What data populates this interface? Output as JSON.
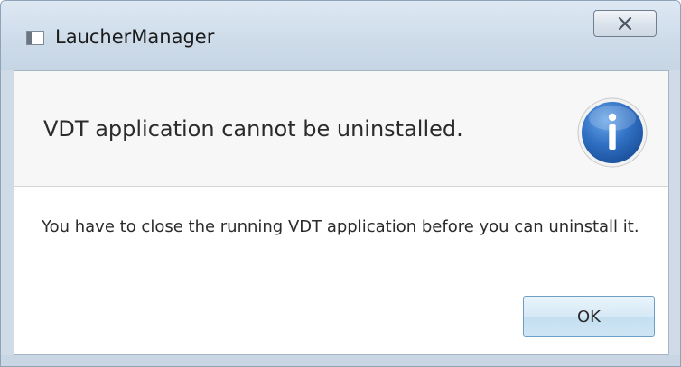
{
  "window": {
    "title": "LaucherManager",
    "app_icon": "application-window-icon",
    "close_icon": "close-x-icon"
  },
  "dialog": {
    "headline": "VDT application cannot be uninstalled.",
    "message": "You have to close the running VDT application before you can uninstall it.",
    "status_icon": "info-icon",
    "ok_label": "OK"
  },
  "colors": {
    "info_blue": "#2f6fc2",
    "frame": "#cfdbe7",
    "button_border": "#6ea0c7"
  }
}
